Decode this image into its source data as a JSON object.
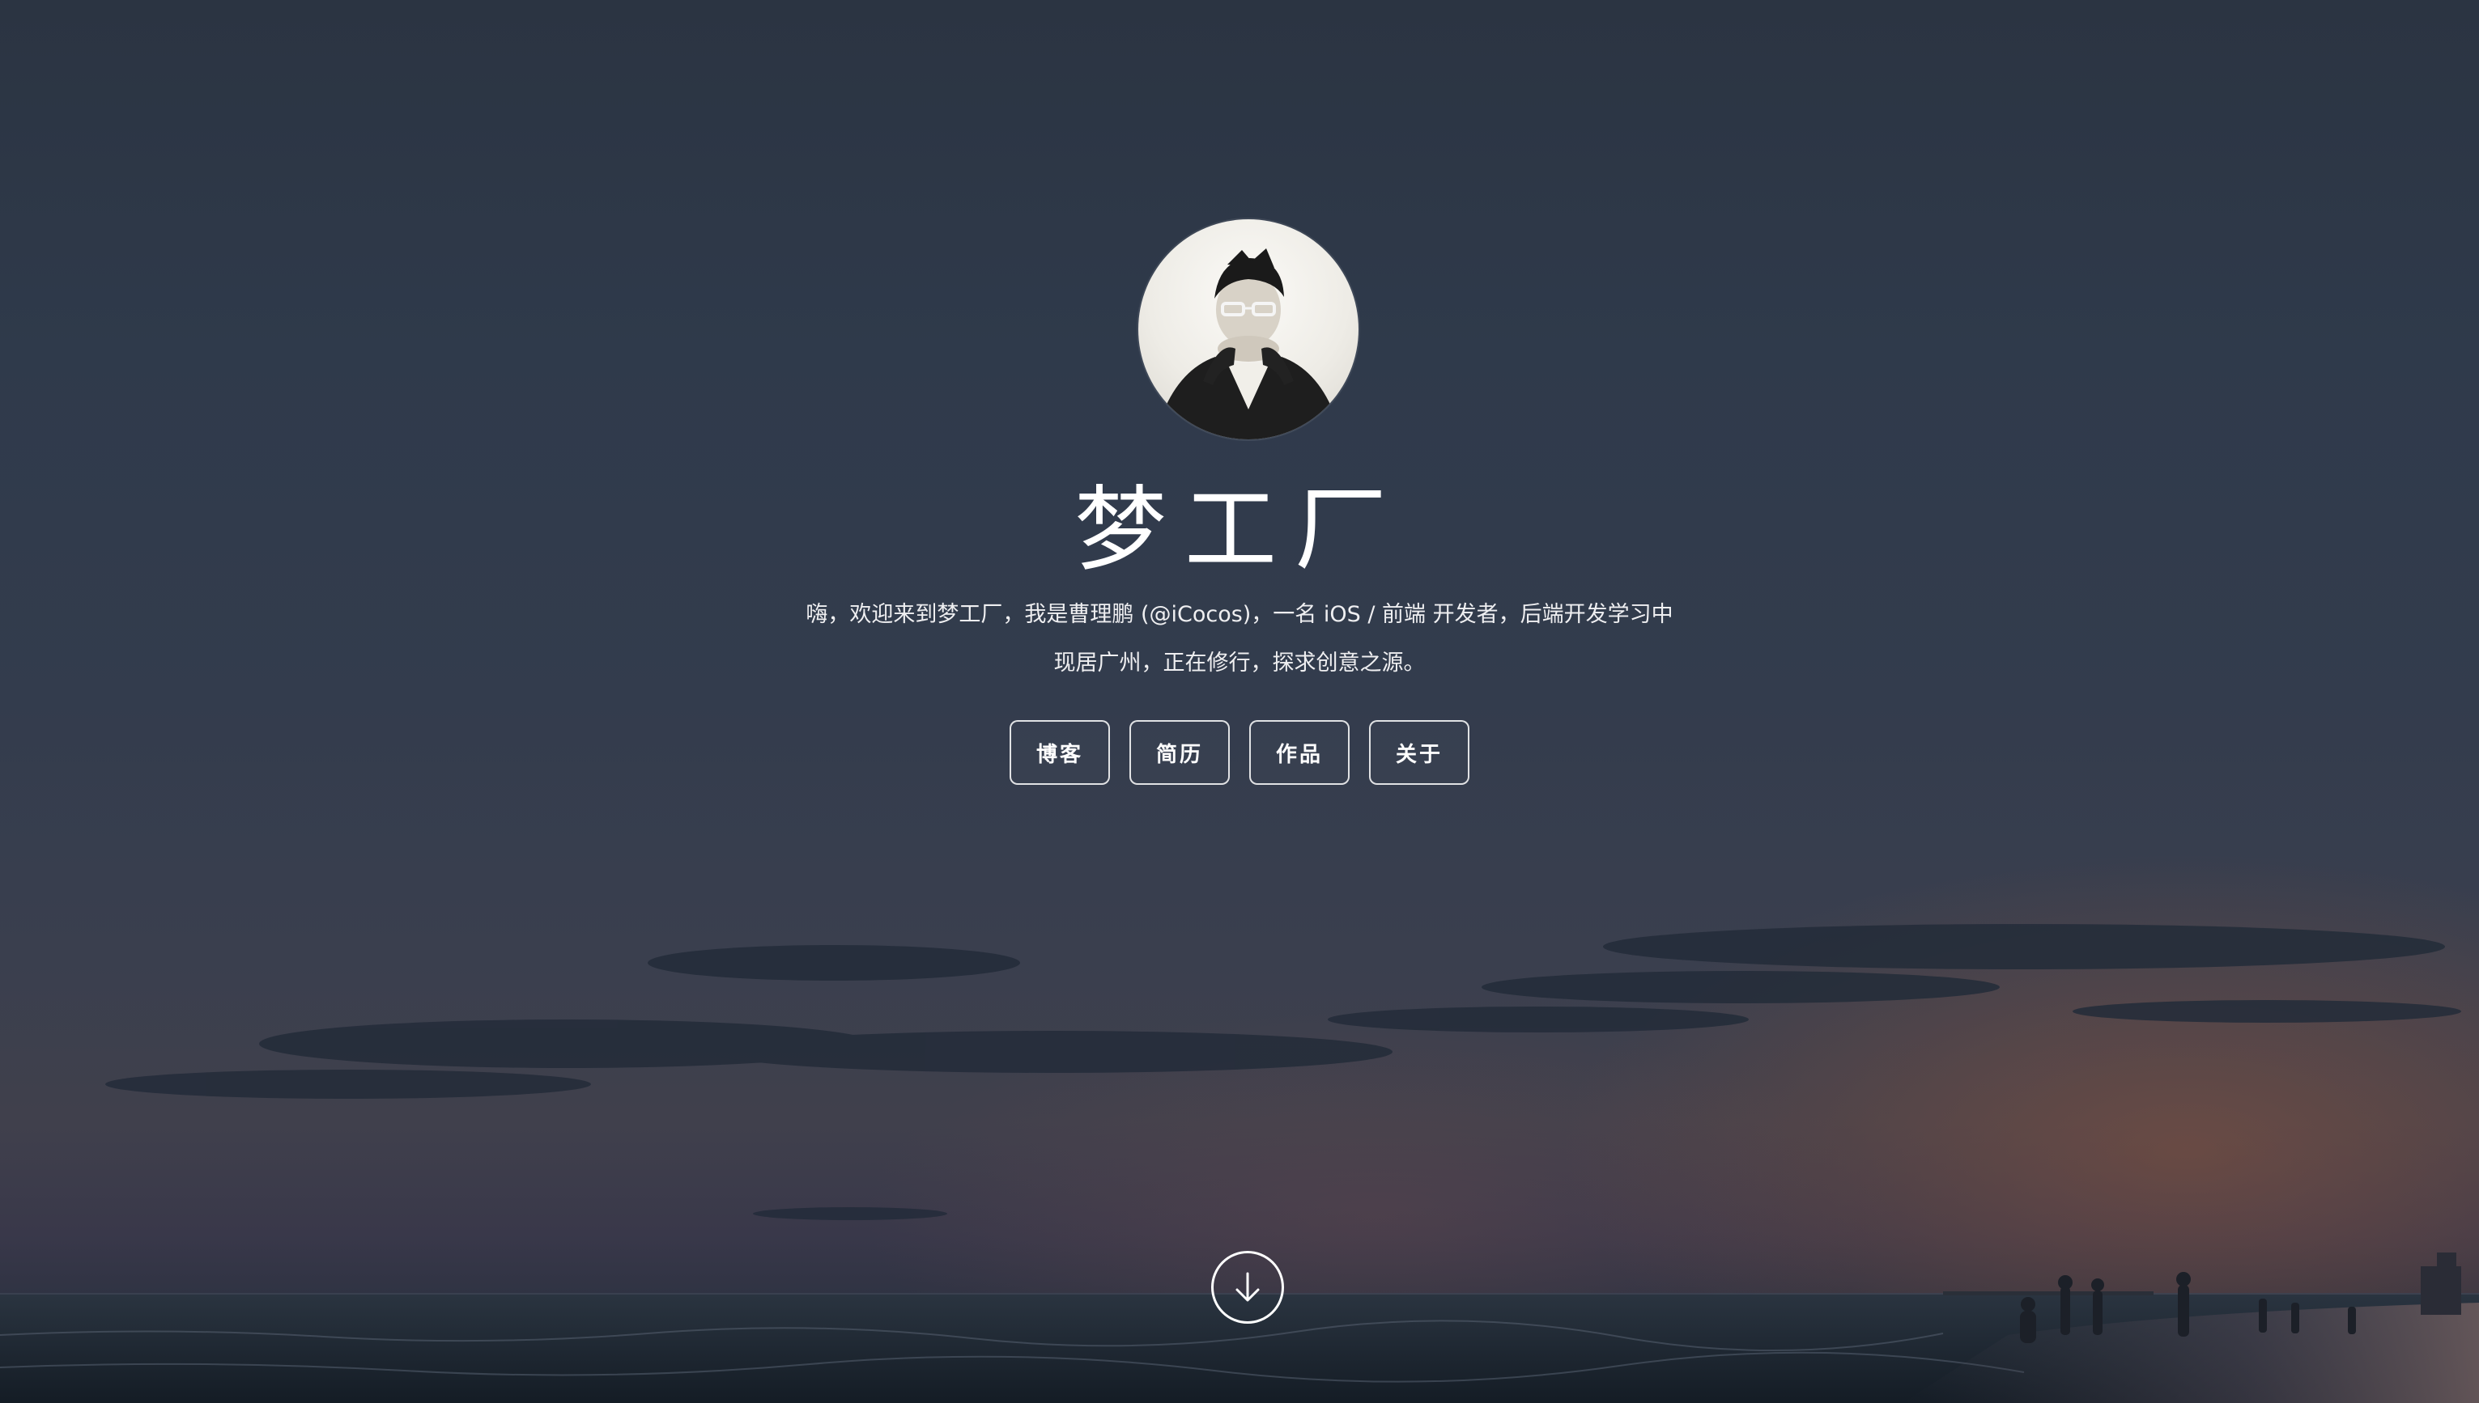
{
  "site": {
    "title": "梦工厂",
    "intro_line1": "嗨，欢迎来到梦工厂，我是曹理鹏 (@iCocos)，一名 iOS / 前端 开发者，后端开发学习中",
    "intro_line2": "现居广州，正在修行，探求创意之源。"
  },
  "nav": {
    "items": [
      {
        "label": "博客"
      },
      {
        "label": "简历"
      },
      {
        "label": "作品"
      },
      {
        "label": "关于"
      }
    ]
  },
  "scroll_down": {
    "icon": "arrow-down-circle-icon"
  },
  "avatar": {
    "icon": "profile-photo"
  },
  "colors": {
    "text": "#ffffff",
    "button_border": "#ffffff",
    "sky_top": "#2b3442",
    "horizon_glow": "#8c543e"
  }
}
